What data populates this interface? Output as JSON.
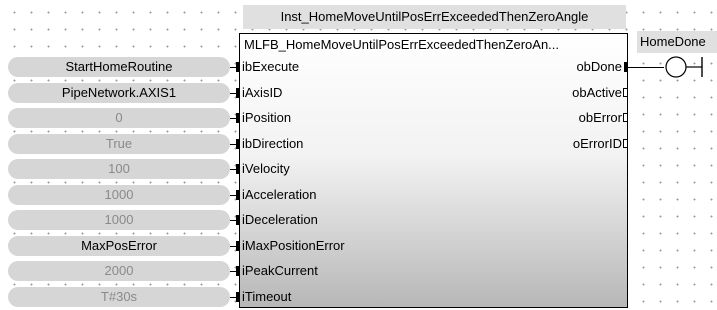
{
  "block": {
    "instance_name": "Inst_HomeMoveUntilPosErrExceededThenZeroAngle",
    "type_name": "MLFB_HomeMoveUntilPosErrExceededThenZeroAn..."
  },
  "inputs": [
    {
      "pin": "ibExecute",
      "value": "StartHomeRoutine",
      "kind": "variable"
    },
    {
      "pin": "iAxisID",
      "value": "PipeNetwork.AXIS1",
      "kind": "variable"
    },
    {
      "pin": "iPosition",
      "value": "0",
      "kind": "constant"
    },
    {
      "pin": "ibDirection",
      "value": "True",
      "kind": "constant"
    },
    {
      "pin": "iVelocity",
      "value": "100",
      "kind": "constant"
    },
    {
      "pin": "iAcceleration",
      "value": "1000",
      "kind": "constant"
    },
    {
      "pin": "iDeceleration",
      "value": "1000",
      "kind": "constant"
    },
    {
      "pin": "iMaxPositionError",
      "value": "MaxPosError",
      "kind": "variable"
    },
    {
      "pin": "iPeakCurrent",
      "value": "2000",
      "kind": "constant"
    },
    {
      "pin": "iTimeout",
      "value": "T#30s",
      "kind": "constant"
    }
  ],
  "outputs": [
    {
      "pin": "obDone",
      "connected": true
    },
    {
      "pin": "obActive",
      "connected": false
    },
    {
      "pin": "obError",
      "connected": false
    },
    {
      "pin": "oErrorID",
      "connected": false
    }
  ],
  "coil": {
    "variable": "HomeDone"
  }
}
